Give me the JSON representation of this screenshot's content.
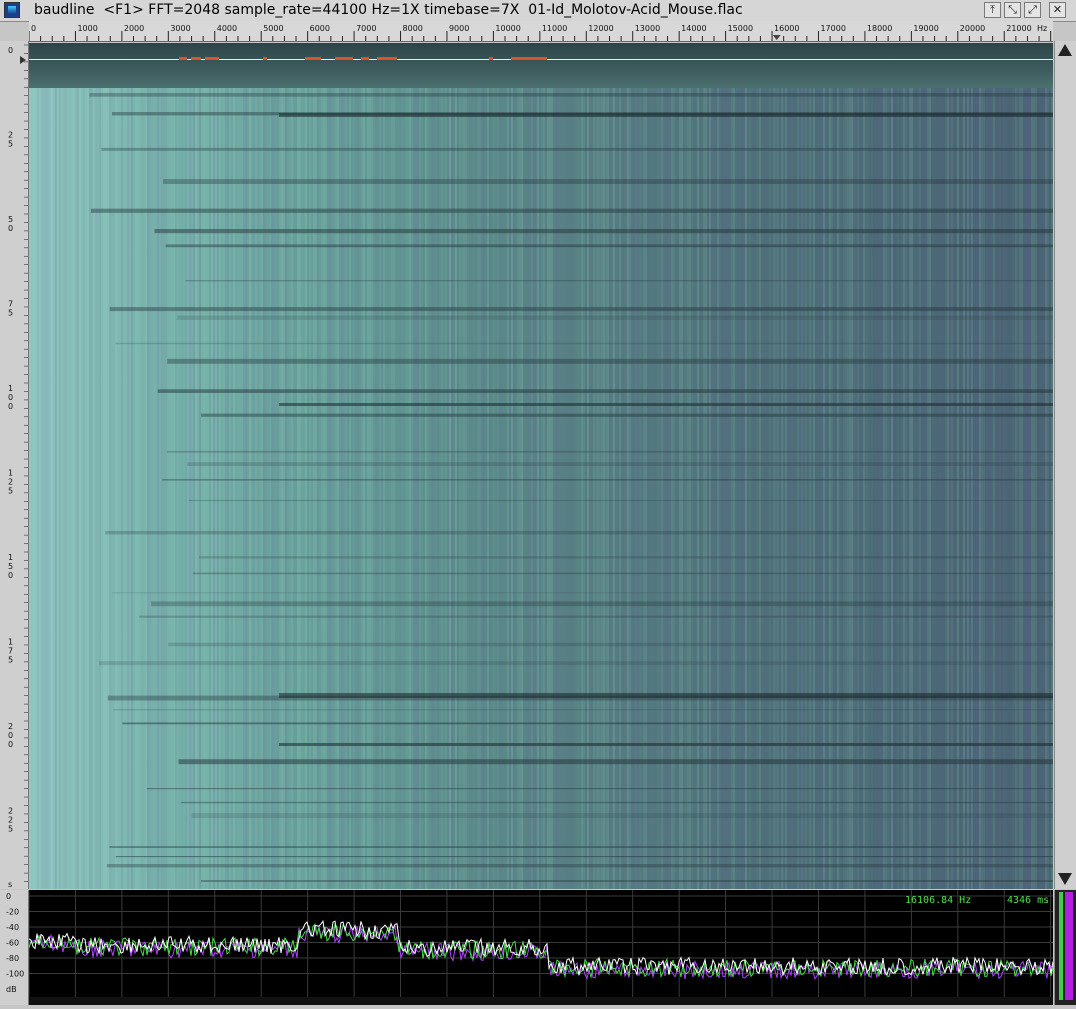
{
  "window": {
    "title": "baudline  <F1> FFT=2048 sample_rate=44100 Hz=1X timebase=7X  01-Id_Molotov-Acid_Mouse.flac",
    "buttons": [
      {
        "name": "raise-button",
        "glyph": "⤒"
      },
      {
        "name": "shrink-button",
        "glyph": "⤡"
      },
      {
        "name": "expand-button",
        "glyph": "⤢"
      },
      {
        "name": "close-button",
        "glyph": "✕"
      }
    ]
  },
  "freq_axis": {
    "ticks": [
      "0",
      "1000",
      "2000",
      "3000",
      "4000",
      "5000",
      "6000",
      "7000",
      "8000",
      "9000",
      "10000",
      "11000",
      "12000",
      "13000",
      "14000",
      "15000",
      "16000",
      "17000",
      "18000",
      "19000",
      "20000",
      "21000"
    ],
    "unit": "Hz",
    "max_hz": 22050,
    "cursor_hz": 16100
  },
  "time_axis": {
    "labels": [
      "0",
      "25",
      "50",
      "75",
      "100",
      "125",
      "150",
      "175",
      "200",
      "225",
      "s"
    ]
  },
  "spectrum": {
    "db_labels": [
      "0",
      "-20",
      "-40",
      "-60",
      "-80",
      "-100",
      "dB"
    ],
    "frequency_readout": "16106.84 Hz",
    "time_readout": "4346 ms"
  },
  "colors": {
    "spectrum_trace": "#ffffff",
    "spectrum_trace_alt": "#b040ff",
    "spectrum_trace_green": "#40e040",
    "readout": "#4fe04f",
    "marker": "#d9542a"
  }
}
